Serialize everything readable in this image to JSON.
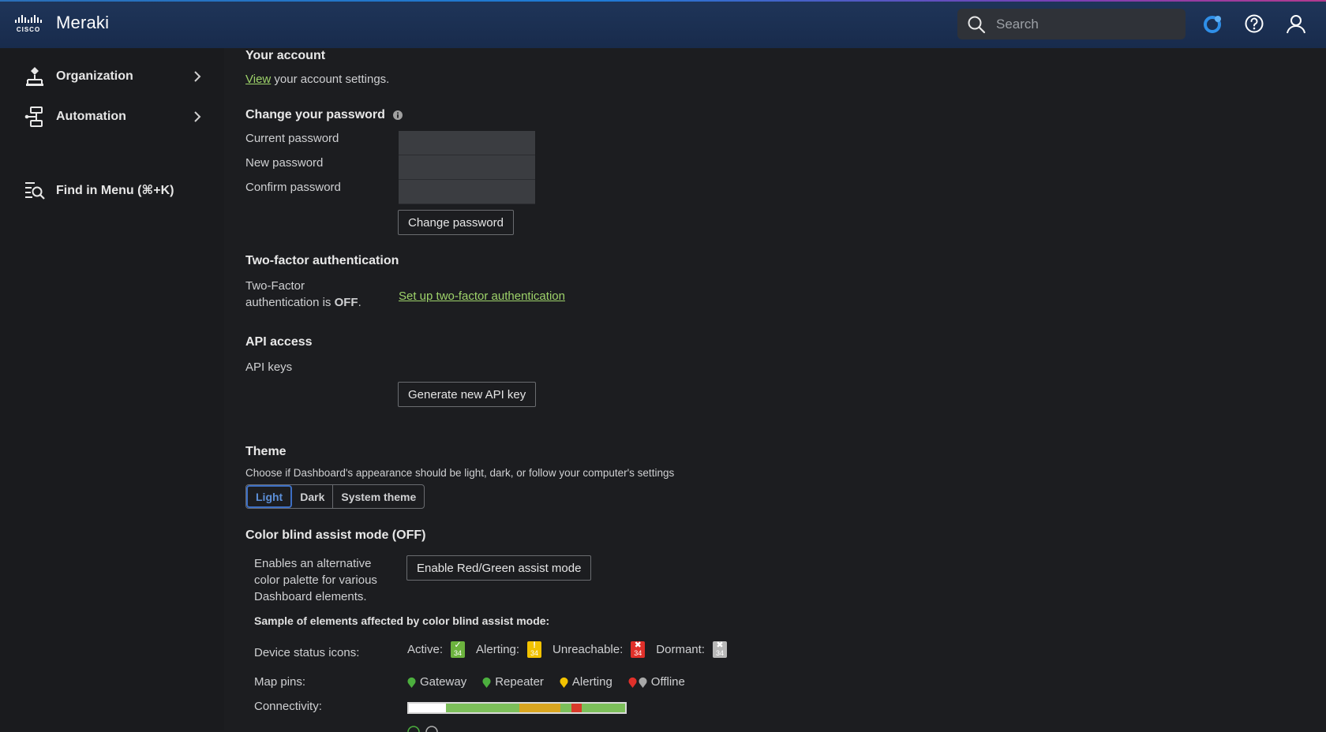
{
  "header": {
    "brand": "Meraki",
    "search_placeholder": "Search"
  },
  "sidebar": {
    "items": [
      {
        "label": "Organization"
      },
      {
        "label": "Automation"
      },
      {
        "label": "Find in Menu (⌘+K)"
      }
    ]
  },
  "account": {
    "heading": "Your account",
    "view_link": "View",
    "view_rest": " your account settings."
  },
  "password": {
    "heading": "Change your password",
    "current_label": "Current password",
    "new_label": "New password",
    "confirm_label": "Confirm password",
    "button": "Change password"
  },
  "two_factor": {
    "heading": "Two-factor authentication",
    "status_line1": "Two-Factor",
    "status_line2_prefix": "authentication is ",
    "status_value": "OFF",
    "status_suffix": ".",
    "setup_link": "Set up two-factor authentication"
  },
  "api": {
    "heading": "API access",
    "keys_label": "API keys",
    "button": "Generate new API key"
  },
  "theme": {
    "heading": "Theme",
    "description": "Choose if Dashboard's appearance should be light, dark, or follow your computer's settings",
    "options": [
      "Light",
      "Dark",
      "System theme"
    ],
    "selected": "Light"
  },
  "color_blind": {
    "heading": "Color blind assist mode (OFF)",
    "desc_line1": "Enables an alternative",
    "desc_line2": "color palette for various",
    "desc_line3": "Dashboard elements.",
    "button": "Enable Red/Green assist mode",
    "sample_heading": "Sample of elements affected by color blind assist mode:",
    "device_status_label": "Device status icons:",
    "statuses": [
      {
        "label": "Active:",
        "color": "#6cb33e",
        "symbol": "✓",
        "number": "34"
      },
      {
        "label": "Alerting:",
        "color": "#f2c200",
        "symbol": "!",
        "number": "34"
      },
      {
        "label": "Unreachable:",
        "color": "#e0302a",
        "symbol": "✖",
        "number": "34"
      },
      {
        "label": "Dormant:",
        "color": "#b8b8b8",
        "symbol": "✖",
        "number": "34"
      }
    ],
    "map_pins_label": "Map pins:",
    "pins": [
      {
        "label": "Gateway",
        "colors": [
          "#4caf3e"
        ]
      },
      {
        "label": "Repeater",
        "colors": [
          "#4caf3e"
        ]
      },
      {
        "label": "Alerting",
        "colors": [
          "#f2c200"
        ]
      },
      {
        "label": "Offline",
        "colors": [
          "#e0302a",
          "#a8a8a8"
        ]
      }
    ],
    "connectivity_label": "Connectivity:",
    "connectivity_segments": [
      {
        "color": "#ffffff",
        "fraction": 0.17
      },
      {
        "color": "#7cbf5a",
        "fraction": 0.34
      },
      {
        "color": "#d9a520",
        "fraction": 0.19
      },
      {
        "color": "#7cbf5a",
        "fraction": 0.05
      },
      {
        "color": "#d83a2a",
        "fraction": 0.05
      },
      {
        "color": "#7cbf5a",
        "fraction": 0.2
      }
    ]
  },
  "colors": {
    "accent_link": "#9ed36a",
    "header_bg": "#1f3559",
    "page_bg": "#1c1d20"
  }
}
